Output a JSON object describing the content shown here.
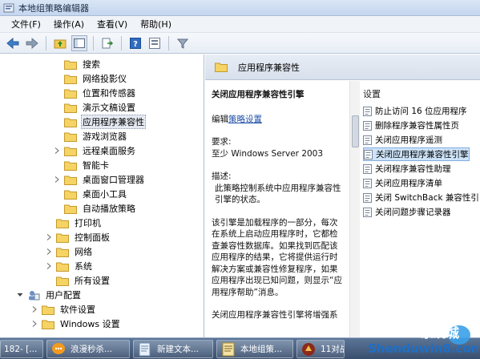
{
  "window": {
    "title": "本地组策略编辑器"
  },
  "menu": [
    "文件(F)",
    "操作(A)",
    "查看(V)",
    "帮助(H)"
  ],
  "tree": [
    {
      "label": "搜索",
      "indent": 3,
      "arrow": "",
      "selected": false
    },
    {
      "label": "网络投影仪",
      "indent": 3,
      "arrow": "",
      "selected": false
    },
    {
      "label": "位置和传感器",
      "indent": 3,
      "arrow": "",
      "selected": false
    },
    {
      "label": "演示文稿设置",
      "indent": 3,
      "arrow": "",
      "selected": false
    },
    {
      "label": "应用程序兼容性",
      "indent": 3,
      "arrow": "",
      "selected": true
    },
    {
      "label": "游戏浏览器",
      "indent": 3,
      "arrow": "",
      "selected": false
    },
    {
      "label": "远程桌面服务",
      "indent": 3,
      "arrow": "right",
      "selected": false
    },
    {
      "label": "智能卡",
      "indent": 3,
      "arrow": "",
      "selected": false
    },
    {
      "label": "桌面窗口管理器",
      "indent": 3,
      "arrow": "right",
      "selected": false
    },
    {
      "label": "桌面小工具",
      "indent": 3,
      "arrow": "",
      "selected": false
    },
    {
      "label": "自动播放策略",
      "indent": 3,
      "arrow": "",
      "selected": false
    },
    {
      "label": "打印机",
      "indent": 2,
      "arrow": "",
      "selected": false
    },
    {
      "label": "控制面板",
      "indent": 2,
      "arrow": "right",
      "selected": false
    },
    {
      "label": "网络",
      "indent": 2,
      "arrow": "right",
      "selected": false
    },
    {
      "label": "系统",
      "indent": 2,
      "arrow": "right",
      "selected": false
    },
    {
      "label": "所有设置",
      "indent": 2,
      "arrow": "",
      "selected": false
    },
    {
      "label": "用户配置",
      "indent": 0,
      "arrow": "down",
      "selected": false
    },
    {
      "label": "软件设置",
      "indent": 1,
      "arrow": "right",
      "selected": false
    },
    {
      "label": "Windows 设置",
      "indent": 1,
      "arrow": "right",
      "selected": false
    }
  ],
  "right_header": "应用程序兼容性",
  "description": {
    "title": "关闭应用程序兼容性引擎",
    "edit_prefix": "编辑",
    "edit_link": "策略设置",
    "requirements_label": "要求:",
    "requirements_value": "至少 Windows Server 2003",
    "desc_label": "描述:",
    "desc_text": "此策略控制系统中应用程序兼容性引擎的状态。",
    "para2": "该引擎是加载程序的一部分，每次在系统上启动应用程序时，它都检查兼容性数据库。如果找到匹配该应用程序的结果，它将提供运行时解决方案或兼容性修复程序，如果应用程序出现已知问题，则显示“应用程序帮助”消息。",
    "para3": "关闭应用程序兼容性引擎将增强系"
  },
  "settings": {
    "column_header": "设置",
    "items": [
      {
        "label": "防止访问 16 位应用程序",
        "selected": false
      },
      {
        "label": "删除程序兼容性属性页",
        "selected": false
      },
      {
        "label": "关闭应用程序遥测",
        "selected": false
      },
      {
        "label": "关闭应用程序兼容性引擎",
        "selected": true
      },
      {
        "label": "关闭程序兼容性助理",
        "selected": false
      },
      {
        "label": "关闭应用程序清单",
        "selected": false
      },
      {
        "label": "关闭 SwitchBack 兼容性引",
        "selected": false
      },
      {
        "label": "关闭问题步骤记录器",
        "selected": false
      }
    ]
  },
  "taskbar": [
    {
      "label": "182- [...",
      "icon": "none-icon"
    },
    {
      "label": "浪漫秒杀...",
      "icon": "chat-bubble-icon"
    },
    {
      "label": "新建文本...",
      "icon": "notepad-icon"
    },
    {
      "label": "本地组策...",
      "icon": "policy-editor-icon"
    },
    {
      "label": "11对战...",
      "icon": "game-icon"
    }
  ],
  "watermark": {
    "line1": "系统城",
    "line2": "Shenduwin8.com"
  },
  "colors": {
    "selection": "#cde3f9",
    "link": "#1f4fa8",
    "taskbar": "#3a4f6e"
  }
}
